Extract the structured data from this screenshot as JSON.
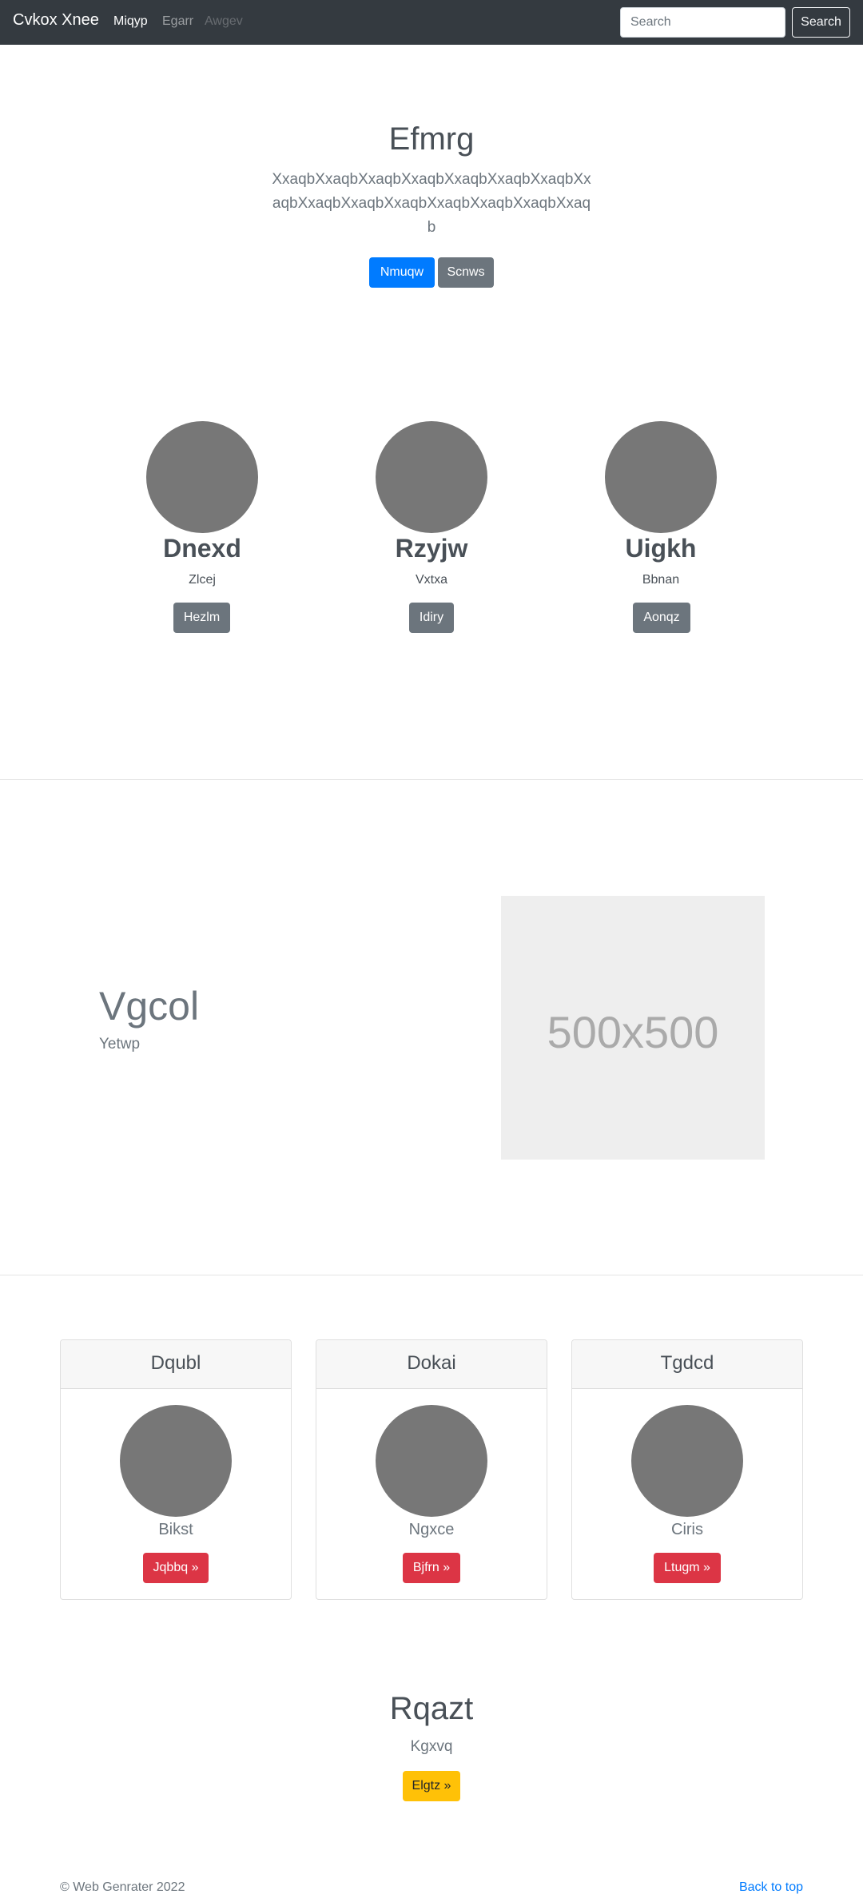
{
  "navbar": {
    "brand": "Cvkox Xnee",
    "links": [
      "Miqyp",
      "Egarr",
      "Awgev"
    ],
    "search_placeholder": "Search",
    "search_button": "Search"
  },
  "hero": {
    "title": "Efmrg",
    "text": "XxaqbXxaqbXxaqbXxaqbXxaqbXxaqbXxaqbXxaqbXxaqbXxaqbXxaqbXxaqbXxaqbXxaqbXxaqb",
    "primary_button": "Nmuqw",
    "secondary_button": "Scnws"
  },
  "marketing": [
    {
      "name": "Dnexd",
      "sub": "Zlcej",
      "button": "Hezlm"
    },
    {
      "name": "Rzyjw",
      "sub": "Vxtxa",
      "button": "Idiry"
    },
    {
      "name": "Uigkh",
      "sub": "Bbnan",
      "button": "Aonqz"
    }
  ],
  "feature": {
    "heading": "Vgcol",
    "sub": "Yetwp",
    "image_label": "500x500"
  },
  "cards": [
    {
      "title": "Dqubl",
      "sub": "Bikst",
      "button": "Jqbbq »"
    },
    {
      "title": "Dokai",
      "sub": "Ngxce",
      "button": "Bjfrn »"
    },
    {
      "title": "Tgdcd",
      "sub": "Ciris",
      "button": "Ltugm »"
    }
  ],
  "cta": {
    "title": "Rqazt",
    "sub": "Kgxvq",
    "button": "Elgtz »"
  },
  "footer": {
    "copyright": "© Web Genrater 2022",
    "back_to_top": "Back to top"
  },
  "colors": {
    "navbar": "#343a40",
    "primary": "#007bff",
    "secondary": "#6c757d",
    "danger": "#dc3545",
    "warning": "#ffc107",
    "placeholder_circle": "#777777"
  }
}
